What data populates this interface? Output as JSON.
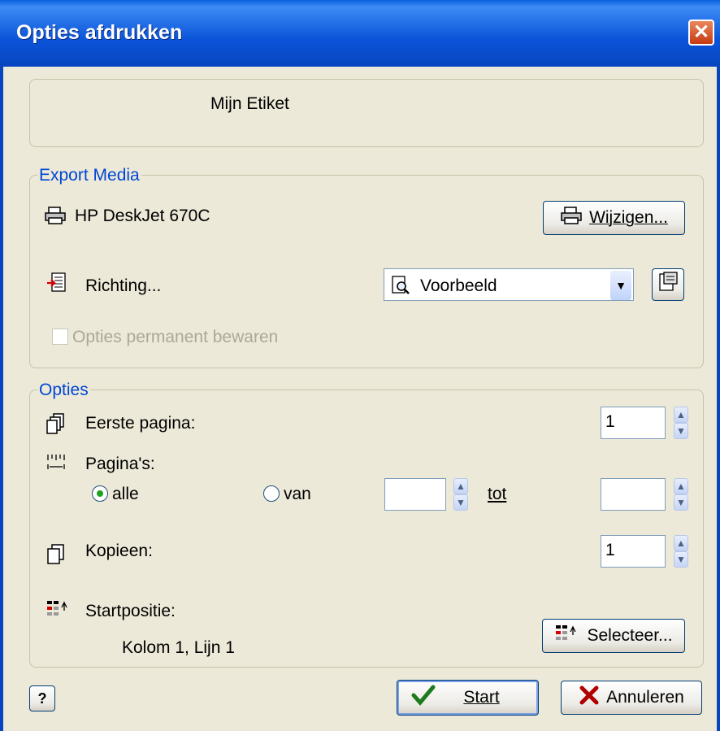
{
  "window": {
    "title": "Opties afdrukken",
    "close_glyph": "✕"
  },
  "label_name": "Mijn Etiket",
  "export_media": {
    "legend": "Export Media",
    "printer_name": "HP DeskJet 670C",
    "change_button": "Wijzigen...",
    "direction_label": "Richting...",
    "direction_value": "Voorbeeld",
    "save_options_label": "Opties permanent bewaren"
  },
  "options": {
    "legend": "Opties",
    "first_page_label": "Eerste pagina:",
    "first_page_value": "1",
    "pages_label": "Pagina's:",
    "radio_all": "alle",
    "radio_from": "van",
    "from_value": "",
    "to_label": "tot",
    "to_value": "",
    "copies_label": "Kopieen:",
    "copies_value": "1",
    "start_position_label": "Startpositie:",
    "start_position_value": "Kolom 1, Lijn 1",
    "select_button": "Selecteer..."
  },
  "footer": {
    "help_glyph": "?",
    "start_button": "Start",
    "cancel_button": "Annuleren"
  },
  "icons": {
    "printer": "printer-icon",
    "direction": "page-direction-icon",
    "preview": "magnifier-page-icon",
    "properties": "properties-icon",
    "pages": "pages-icon",
    "ruler": "ruler-icon",
    "copies": "copies-icon",
    "grid": "grid-icon",
    "check": "check-icon",
    "cross": "cross-icon",
    "help": "help-icon"
  },
  "colors": {
    "titlebar": "#0A53D8",
    "legend": "#0046D5",
    "dialog": "#ECE9D8"
  }
}
